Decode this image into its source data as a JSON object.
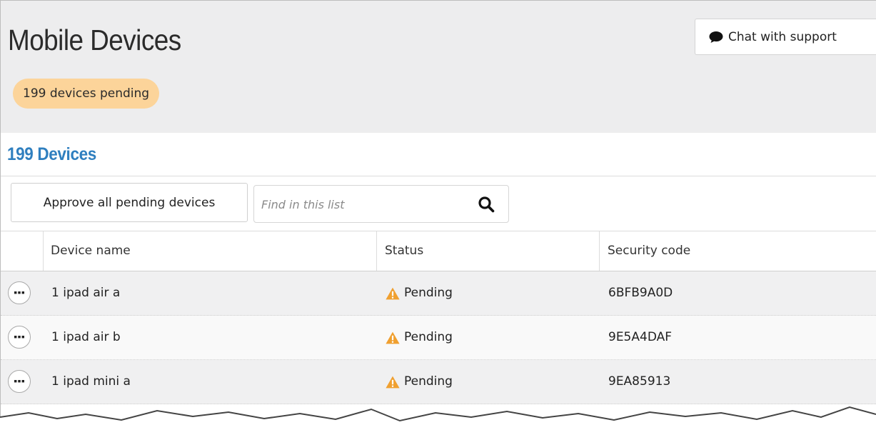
{
  "page": {
    "title": "Mobile Devices",
    "pending_badge": "199 devices pending",
    "chat_button_label": "Chat with support"
  },
  "devices": {
    "heading": "199 Devices",
    "approve_all_label": "Approve all pending devices",
    "search_placeholder": "Find in this list"
  },
  "table": {
    "columns": [
      "Device name",
      "Status",
      "Security code"
    ],
    "rows": [
      {
        "name": "1 ipad air a",
        "status": "Pending",
        "code": "6BFB9A0D"
      },
      {
        "name": "1 ipad air b",
        "status": "Pending",
        "code": "9E5A4DAF"
      },
      {
        "name": "1 ipad mini a",
        "status": "Pending",
        "code": "9EA85913"
      }
    ]
  },
  "colors": {
    "heading_blue": "#2f7fbf",
    "badge_orange": "#fcd49a",
    "warning_orange": "#f0a030",
    "header_bg": "#ededee"
  },
  "icons": {
    "chat": "speech-bubble-icon",
    "search": "magnifier-icon",
    "row_actions": "ellipsis-icon",
    "status": "warning-triangle-icon"
  }
}
